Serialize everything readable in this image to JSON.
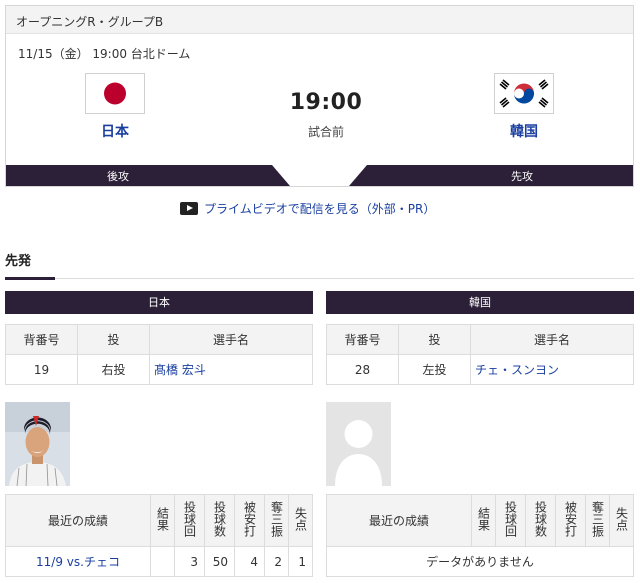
{
  "game": {
    "round": "オープニングR・グループB",
    "date": "11/15（金） 19:00 台北ドーム",
    "time": "19:00",
    "status": "試合前",
    "home": {
      "name": "日本",
      "order": "後攻",
      "flag": "japan-flag"
    },
    "away": {
      "name": "韓国",
      "order": "先攻",
      "flag": "korea-flag"
    }
  },
  "prime_link": "プライムビデオで配信を見る（外部・PR）",
  "section_title": "先発",
  "starter_headers": [
    "背番号",
    "投",
    "選手名"
  ],
  "recent_headers": [
    "最近の成績",
    "結果",
    "投球回",
    "投球数",
    "被安打",
    "奪三振",
    "失点"
  ],
  "japan": {
    "team": "日本",
    "starter": {
      "number": "19",
      "throws": "右投",
      "name": "髙橋 宏斗"
    },
    "recent": [
      {
        "game": "11/9 vs.チェコ",
        "result": "",
        "ip": "3",
        "pitches": "50",
        "hits": "4",
        "so": "2",
        "runs": "1"
      }
    ]
  },
  "korea": {
    "team": "韓国",
    "starter": {
      "number": "28",
      "throws": "左投",
      "name": "チェ・スンヨン"
    },
    "no_data": "データがありません"
  },
  "colors": {
    "accent": "#2c2038",
    "link": "#1a3fa0",
    "japan_red": "#bc002d",
    "korea_red": "#cd2e3a",
    "korea_blue": "#0047a0"
  }
}
